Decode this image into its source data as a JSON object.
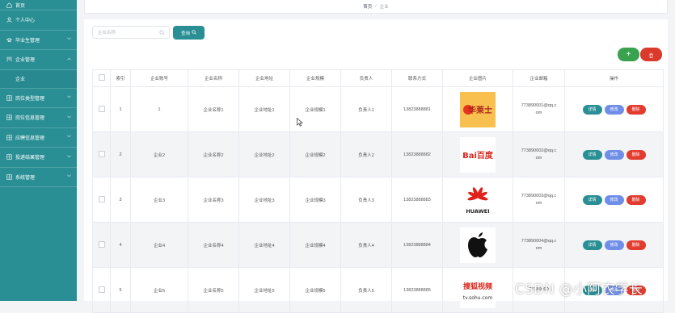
{
  "sidebar": {
    "items": [
      {
        "label": "首页",
        "icon": "home-icon"
      },
      {
        "label": "个人中心",
        "icon": "user-icon"
      },
      {
        "label": "毕业生管理",
        "icon": "graduate-icon"
      },
      {
        "label": "企业管理",
        "icon": "company-icon"
      },
      {
        "label": "岗位类型管理",
        "icon": "grid-icon"
      },
      {
        "label": "岗位信息管理",
        "icon": "grid-icon"
      },
      {
        "label": "应聘信息管理",
        "icon": "grid-icon"
      },
      {
        "label": "投递结果管理",
        "icon": "grid-icon"
      },
      {
        "label": "系统管理",
        "icon": "grid-icon"
      }
    ],
    "sub_item": "企业"
  },
  "breadcrumb": {
    "home": "首页",
    "separator": "/",
    "current": "企业"
  },
  "search": {
    "placeholder": "企业名称",
    "button": "查询"
  },
  "actions": {
    "add": "+"
  },
  "table": {
    "headers": [
      "索引",
      "企业账号",
      "企业名称",
      "企业地址",
      "企业规模",
      "负责人",
      "联系方式",
      "企业图片",
      "企业邮箱",
      "操作"
    ],
    "rows": [
      {
        "index": "1",
        "account": "1",
        "name": "企业名称1",
        "address": "企业地址1",
        "scale": "企业规模1",
        "manager": "负责人1",
        "phone": "13823888881",
        "logo": "华莱士",
        "email_l1": "773890001@qq.c",
        "email_l2": "om"
      },
      {
        "index": "2",
        "account": "企业2",
        "name": "企业名称2",
        "address": "企业地址2",
        "scale": "企业规模2",
        "manager": "负责人2",
        "phone": "13823888882",
        "logo": "Bai百度",
        "email_l1": "773890002@qq.c",
        "email_l2": "om"
      },
      {
        "index": "3",
        "account": "企业3",
        "name": "企业名称3",
        "address": "企业地址3",
        "scale": "企业规模3",
        "manager": "负责人3",
        "phone": "13823888883",
        "logo": "HUAWEI",
        "email_l1": "773890003@qq.c",
        "email_l2": "om"
      },
      {
        "index": "4",
        "account": "企业4",
        "name": "企业名称4",
        "address": "企业地址4",
        "scale": "企业规模4",
        "manager": "负责人4",
        "phone": "13823888884",
        "logo": "apple",
        "email_l1": "773890004@qq.c",
        "email_l2": "om"
      },
      {
        "index": "5",
        "account": "企业5",
        "name": "企业名称5",
        "address": "企业地址5",
        "scale": "企业规模5",
        "manager": "负责人5",
        "phone": "13823888885",
        "logo": "搜狐视频",
        "logo_sub": "tv.sohu.com",
        "email_l1": "77389000",
        "email_l2": ""
      }
    ],
    "ops": {
      "detail": "详情",
      "edit": "修改",
      "delete": "删除"
    }
  },
  "watermark": "CSDN @小阿农学长",
  "colors": {
    "primary": "#2a8f95",
    "add": "#3aa24f",
    "danger": "#d93a2b",
    "edit": "#6f8ee8"
  }
}
